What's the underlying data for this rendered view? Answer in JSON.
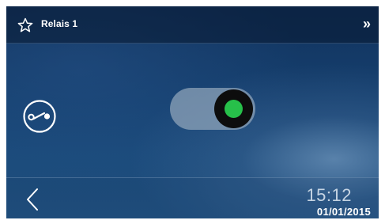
{
  "header": {
    "title": "Relais 1",
    "favorite_icon": "star-outline-icon",
    "more_label": "»"
  },
  "main": {
    "relay_icon": "relay-switch-icon",
    "toggle": {
      "state": "on",
      "knob_color": "#27c04a"
    }
  },
  "footer": {
    "back_icon": "chevron-left-icon",
    "time": "15:12",
    "date": "01/01/2015"
  }
}
